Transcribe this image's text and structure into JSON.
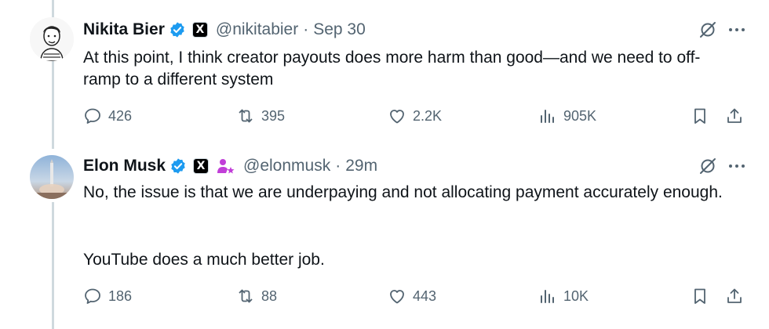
{
  "tweets": [
    {
      "author_name": "Nikita Bier",
      "handle": "@nikitabier",
      "separator": "·",
      "time": "Sep 30",
      "text": "At this point, I think creator payouts does more harm than good—and we need to off-ramp to a different system",
      "replies": "426",
      "reposts": "395",
      "likes": "2.2K",
      "views": "905K",
      "badges": [
        "verified-icon",
        "x-affiliate-icon"
      ]
    },
    {
      "author_name": "Elon Musk",
      "handle": "@elonmusk",
      "separator": "·",
      "time": "29m",
      "text_line1": "No, the issue is that we are underpaying and not allocating payment accurately enough.",
      "text_line2": "YouTube does a much better job.",
      "replies": "186",
      "reposts": "88",
      "likes": "443",
      "views": "10K",
      "badges": [
        "verified-icon",
        "x-affiliate-icon",
        "affiliate-person-icon"
      ]
    }
  ],
  "colors": {
    "text": "#0f1419",
    "secondary": "#536471",
    "verified": "#1d9bf0",
    "affiliate": "#c13ed8",
    "thread_line": "#cfd9de"
  },
  "x_badge_glyph": "X"
}
